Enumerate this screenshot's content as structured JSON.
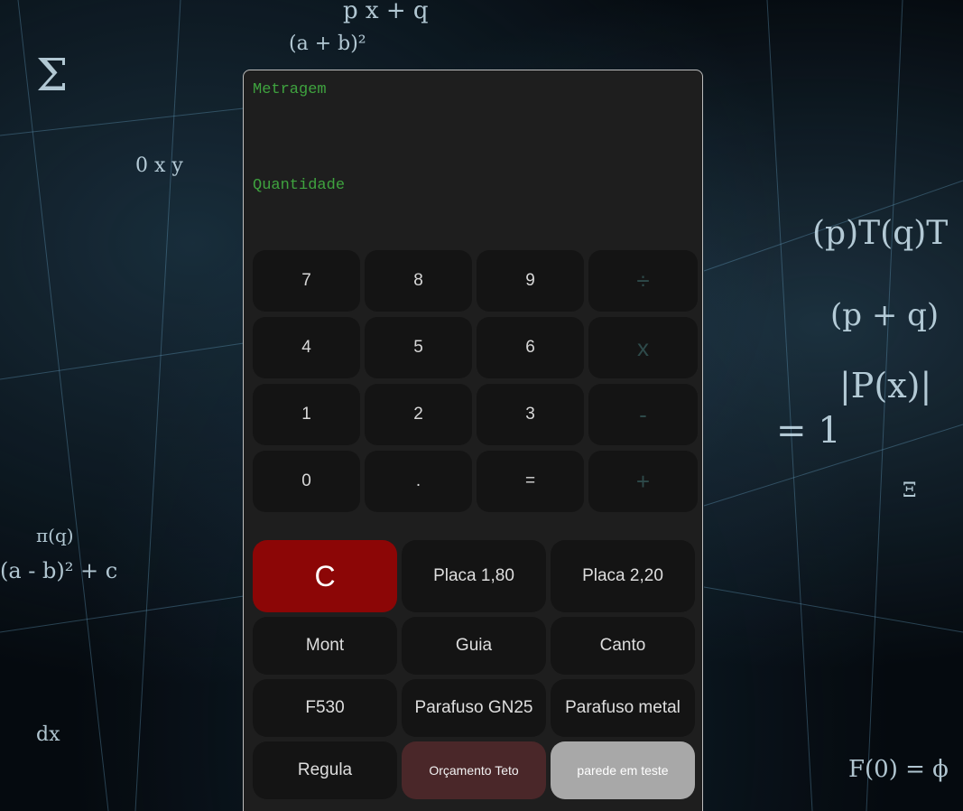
{
  "display": {
    "metragem_label": "Metragem",
    "quantidade_label": "Quantidade"
  },
  "keypad": {
    "keys": [
      "7",
      "8",
      "9",
      "÷",
      "4",
      "5",
      "6",
      "x",
      "1",
      "2",
      "3",
      "-",
      "0",
      ".",
      "=",
      "+"
    ]
  },
  "functions": {
    "clear": "C",
    "placa_180": "Placa 1,80",
    "placa_220": "Placa 2,20",
    "mont": "Mont",
    "guia": "Guia",
    "canto": "Canto",
    "f530": "F530",
    "parafuso_gn25": "Parafuso GN25",
    "parafuso_metal": "Parafuso metal",
    "regula": "Regula",
    "orcamento_teto": "Orçamento Teto",
    "parede_em_teste": "parede em teste"
  },
  "background": {
    "formulas": [
      "p x + q",
      "Σ",
      "(a + b)²",
      "0 x y",
      "(p)T(q)T",
      "(p + q)",
      "|P(x)|",
      "= 1",
      "F(0) = ϕ",
      "(a - b)² + c",
      "π(q)",
      "dx",
      "Ξ"
    ]
  },
  "colors": {
    "panel": "#1e1e1e",
    "key": "#141414",
    "label_green": "#3fa33f",
    "clear_red": "#8c0606",
    "orcamento": "#4a2729",
    "parede": "#a8a8a8"
  }
}
